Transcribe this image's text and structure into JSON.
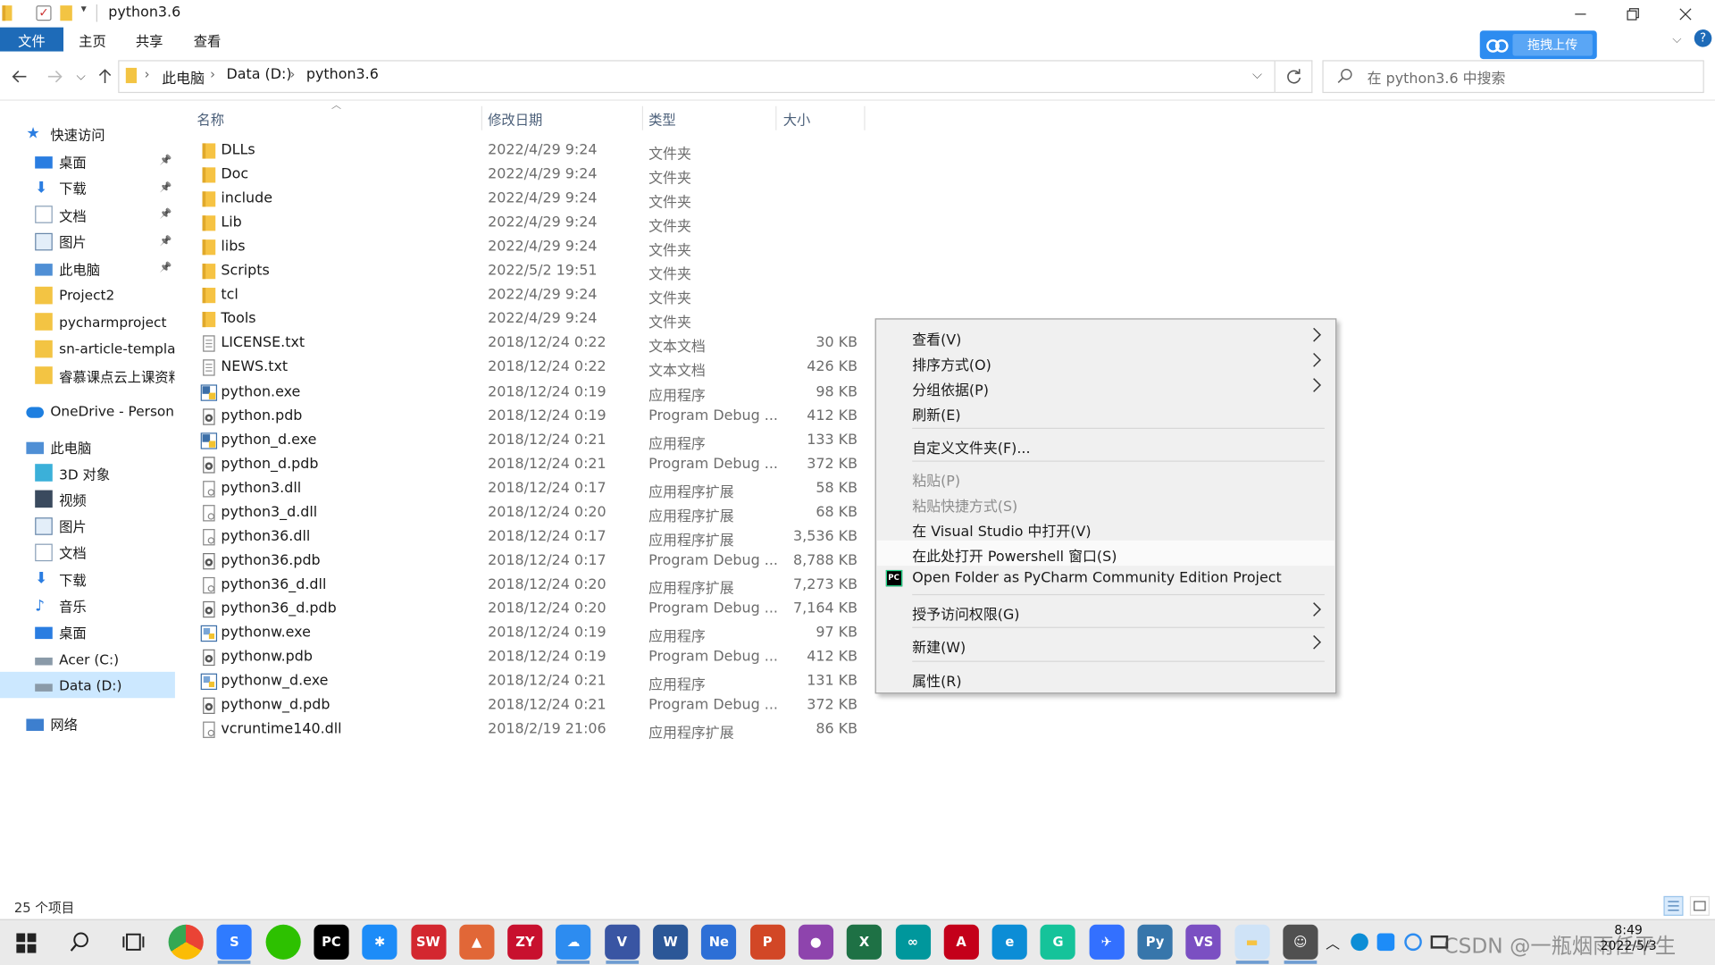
{
  "window": {
    "title": "python3.6"
  },
  "ribbon": {
    "tabs": [
      "文件",
      "主页",
      "共享",
      "查看"
    ],
    "upload_label": "拖拽上传"
  },
  "nav": {
    "breadcrumbs": [
      "此电脑",
      "Data (D:)",
      "python3.6"
    ],
    "search_placeholder": "在 python3.6 中搜索"
  },
  "sidebar": {
    "quick_access": "快速访问",
    "quick_items": [
      "桌面",
      "下载",
      "文档",
      "图片",
      "此电脑",
      "Project2",
      "pycharmproject",
      "sn-article-templat",
      "睿慕课点云上课资料"
    ],
    "onedrive": "OneDrive - Persona",
    "this_pc": "此电脑",
    "pc_items": [
      "3D 对象",
      "视频",
      "图片",
      "文档",
      "下载",
      "音乐",
      "桌面",
      "Acer (C:)",
      "Data (D:)"
    ],
    "network": "网络"
  },
  "columns": {
    "name": "名称",
    "date": "修改日期",
    "type": "类型",
    "size": "大小"
  },
  "files": [
    {
      "name": "DLLs",
      "date": "2022/4/29 9:24",
      "type": "文件夹",
      "size": "",
      "icon": "folder"
    },
    {
      "name": "Doc",
      "date": "2022/4/29 9:24",
      "type": "文件夹",
      "size": "",
      "icon": "folder"
    },
    {
      "name": "include",
      "date": "2022/4/29 9:24",
      "type": "文件夹",
      "size": "",
      "icon": "folder"
    },
    {
      "name": "Lib",
      "date": "2022/4/29 9:24",
      "type": "文件夹",
      "size": "",
      "icon": "folder"
    },
    {
      "name": "libs",
      "date": "2022/4/29 9:24",
      "type": "文件夹",
      "size": "",
      "icon": "folder"
    },
    {
      "name": "Scripts",
      "date": "2022/5/2 19:51",
      "type": "文件夹",
      "size": "",
      "icon": "folder"
    },
    {
      "name": "tcl",
      "date": "2022/4/29 9:24",
      "type": "文件夹",
      "size": "",
      "icon": "folder"
    },
    {
      "name": "Tools",
      "date": "2022/4/29 9:24",
      "type": "文件夹",
      "size": "",
      "icon": "folder"
    },
    {
      "name": "LICENSE.txt",
      "date": "2018/12/24 0:22",
      "type": "文本文档",
      "size": "30 KB",
      "icon": "txt"
    },
    {
      "name": "NEWS.txt",
      "date": "2018/12/24 0:22",
      "type": "文本文档",
      "size": "426 KB",
      "icon": "txt"
    },
    {
      "name": "python.exe",
      "date": "2018/12/24 0:19",
      "type": "应用程序",
      "size": "98 KB",
      "icon": "exe"
    },
    {
      "name": "python.pdb",
      "date": "2018/12/24 0:19",
      "type": "Program Debug ...",
      "size": "412 KB",
      "icon": "pdb"
    },
    {
      "name": "python_d.exe",
      "date": "2018/12/24 0:21",
      "type": "应用程序",
      "size": "133 KB",
      "icon": "exe"
    },
    {
      "name": "python_d.pdb",
      "date": "2018/12/24 0:21",
      "type": "Program Debug ...",
      "size": "372 KB",
      "icon": "pdb"
    },
    {
      "name": "python3.dll",
      "date": "2018/12/24 0:17",
      "type": "应用程序扩展",
      "size": "58 KB",
      "icon": "dll"
    },
    {
      "name": "python3_d.dll",
      "date": "2018/12/24 0:20",
      "type": "应用程序扩展",
      "size": "68 KB",
      "icon": "dll"
    },
    {
      "name": "python36.dll",
      "date": "2018/12/24 0:17",
      "type": "应用程序扩展",
      "size": "3,536 KB",
      "icon": "dll"
    },
    {
      "name": "python36.pdb",
      "date": "2018/12/24 0:17",
      "type": "Program Debug ...",
      "size": "8,788 KB",
      "icon": "pdb"
    },
    {
      "name": "python36_d.dll",
      "date": "2018/12/24 0:20",
      "type": "应用程序扩展",
      "size": "7,273 KB",
      "icon": "dll"
    },
    {
      "name": "python36_d.pdb",
      "date": "2018/12/24 0:20",
      "type": "Program Debug ...",
      "size": "7,164 KB",
      "icon": "pdb"
    },
    {
      "name": "pythonw.exe",
      "date": "2018/12/24 0:19",
      "type": "应用程序",
      "size": "97 KB",
      "icon": "exew"
    },
    {
      "name": "pythonw.pdb",
      "date": "2018/12/24 0:19",
      "type": "Program Debug ...",
      "size": "412 KB",
      "icon": "pdb"
    },
    {
      "name": "pythonw_d.exe",
      "date": "2018/12/24 0:21",
      "type": "应用程序",
      "size": "131 KB",
      "icon": "exew"
    },
    {
      "name": "pythonw_d.pdb",
      "date": "2018/12/24 0:21",
      "type": "Program Debug ...",
      "size": "372 KB",
      "icon": "pdb"
    },
    {
      "name": "vcruntime140.dll",
      "date": "2018/2/19 21:06",
      "type": "应用程序扩展",
      "size": "86 KB",
      "icon": "dll"
    }
  ],
  "status": {
    "count": "25 个项目"
  },
  "context_menu": [
    {
      "label": "查看(V)",
      "sub": true,
      "disabled": false
    },
    {
      "label": "排序方式(O)",
      "sub": true,
      "disabled": false
    },
    {
      "label": "分组依据(P)",
      "sub": true,
      "disabled": false
    },
    {
      "label": "刷新(E)",
      "sub": false,
      "disabled": false
    },
    {
      "label": "自定义文件夹(F)...",
      "sub": false,
      "disabled": false
    },
    {
      "label": "粘贴(P)",
      "sub": false,
      "disabled": true
    },
    {
      "label": "粘贴快捷方式(S)",
      "sub": false,
      "disabled": true
    },
    {
      "label": "在 Visual Studio 中打开(V)",
      "sub": false,
      "disabled": false
    },
    {
      "label": "在此处打开 Powershell 窗口(S)",
      "sub": false,
      "disabled": false
    },
    {
      "label": "Open Folder as PyCharm Community Edition Project",
      "sub": false,
      "disabled": false
    },
    {
      "label": "授予访问权限(G)",
      "sub": true,
      "disabled": false
    },
    {
      "label": "新建(W)",
      "sub": true,
      "disabled": false
    },
    {
      "label": "属性(R)",
      "sub": false,
      "disabled": false
    }
  ],
  "taskbar": {
    "apps": [
      {
        "name": "chrome",
        "label": "",
        "color": "#ffffff"
      },
      {
        "name": "sogou",
        "label": "S",
        "color": "#2f7bff"
      },
      {
        "name": "wechat",
        "label": "",
        "color": "#2dc100"
      },
      {
        "name": "pycharm",
        "label": "PC",
        "color": "#000000"
      },
      {
        "name": "app-blue-star",
        "label": "✱",
        "color": "#1d8cf8"
      },
      {
        "name": "solidworks",
        "label": "SW",
        "color": "#d3272f"
      },
      {
        "name": "matlab",
        "label": "▲",
        "color": "#e16737"
      },
      {
        "name": "zy",
        "label": "ZY",
        "color": "#c8102e"
      },
      {
        "name": "baidu-netdisk",
        "label": "☁",
        "color": "#2d8cf0"
      },
      {
        "name": "visio",
        "label": "V",
        "color": "#3955a3"
      },
      {
        "name": "word",
        "label": "W",
        "color": "#2b5797"
      },
      {
        "name": "note-express",
        "label": "Ne",
        "color": "#2d6fd6"
      },
      {
        "name": "powerpoint",
        "label": "P",
        "color": "#d24726"
      },
      {
        "name": "app-purple",
        "label": "●",
        "color": "#8e44ad"
      },
      {
        "name": "excel",
        "label": "X",
        "color": "#1e7145"
      },
      {
        "name": "arduino",
        "label": "∞",
        "color": "#00979c"
      },
      {
        "name": "acrobat",
        "label": "A",
        "color": "#c4001a"
      },
      {
        "name": "edge",
        "label": "e",
        "color": "#0c8dd6"
      },
      {
        "name": "grammarly",
        "label": "G",
        "color": "#15c39a"
      },
      {
        "name": "feishu",
        "label": "✈",
        "color": "#3370ff"
      },
      {
        "name": "python-idle",
        "label": "Py",
        "color": "#3776ab"
      },
      {
        "name": "visual-studio",
        "label": "VS",
        "color": "#7b4fc2"
      },
      {
        "name": "file-explorer",
        "label": "▬",
        "color": "#f6c343"
      },
      {
        "name": "app-person",
        "label": "☺",
        "color": "#505050"
      }
    ],
    "clock": {
      "time": "8:49",
      "date": "2022/5/3"
    },
    "watermark": "CSDN @一瓶烟雨任平生"
  }
}
